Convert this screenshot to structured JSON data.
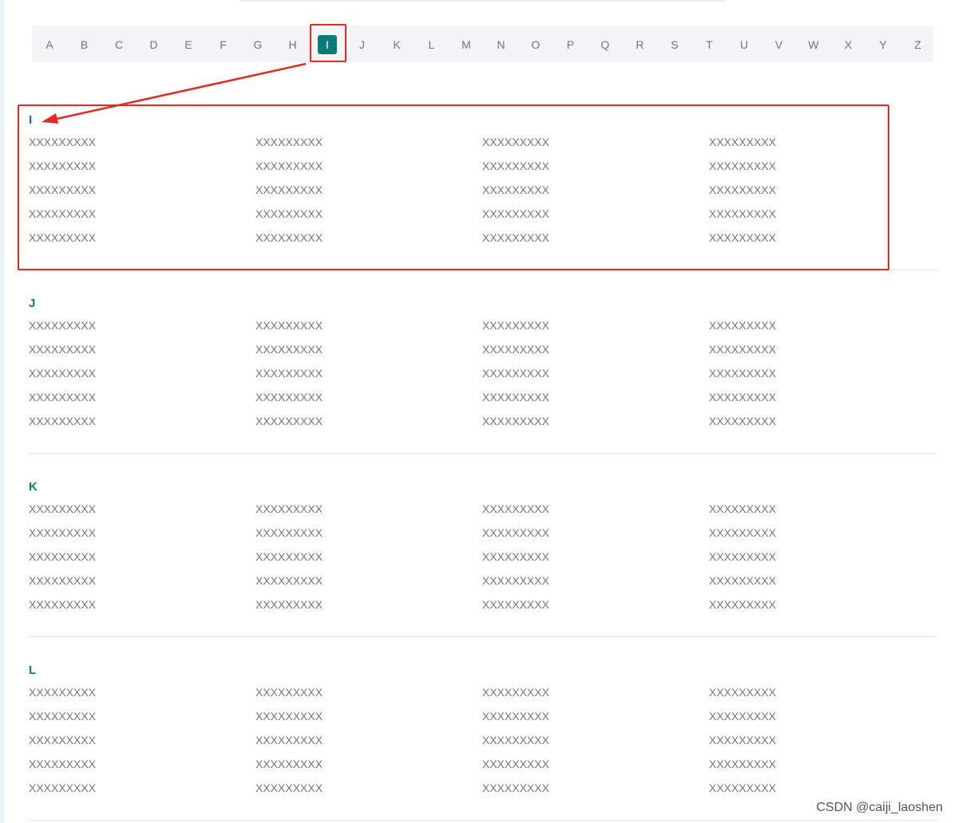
{
  "letters": [
    "A",
    "B",
    "C",
    "D",
    "E",
    "F",
    "G",
    "H",
    "I",
    "J",
    "K",
    "L",
    "M",
    "N",
    "O",
    "P",
    "Q",
    "R",
    "S",
    "T",
    "U",
    "V",
    "W",
    "X",
    "Y",
    "Z"
  ],
  "active_letter": "I",
  "sections": [
    {
      "title": "I",
      "rows": [
        [
          "XXXXXXXXX",
          "XXXXXXXXX",
          "XXXXXXXXX",
          "XXXXXXXXX"
        ],
        [
          "XXXXXXXXX",
          "XXXXXXXXX",
          "XXXXXXXXX",
          "XXXXXXXXX"
        ],
        [
          "XXXXXXXXX",
          "XXXXXXXXX",
          "XXXXXXXXX",
          "XXXXXXXXX"
        ],
        [
          "XXXXXXXXX",
          "XXXXXXXXX",
          "XXXXXXXXX",
          "XXXXXXXXX"
        ],
        [
          "XXXXXXXXX",
          "XXXXXXXXX",
          "XXXXXXXXX",
          "XXXXXXXXX"
        ]
      ]
    },
    {
      "title": "J",
      "rows": [
        [
          "XXXXXXXXX",
          "XXXXXXXXX",
          "XXXXXXXXX",
          "XXXXXXXXX"
        ],
        [
          "XXXXXXXXX",
          "XXXXXXXXX",
          "XXXXXXXXX",
          "XXXXXXXXX"
        ],
        [
          "XXXXXXXXX",
          "XXXXXXXXX",
          "XXXXXXXXX",
          "XXXXXXXXX"
        ],
        [
          "XXXXXXXXX",
          "XXXXXXXXX",
          "XXXXXXXXX",
          "XXXXXXXXX"
        ],
        [
          "XXXXXXXXX",
          "XXXXXXXXX",
          "XXXXXXXXX",
          "XXXXXXXXX"
        ]
      ]
    },
    {
      "title": "K",
      "rows": [
        [
          "XXXXXXXXX",
          "XXXXXXXXX",
          "XXXXXXXXX",
          "XXXXXXXXX"
        ],
        [
          "XXXXXXXXX",
          "XXXXXXXXX",
          "XXXXXXXXX",
          "XXXXXXXXX"
        ],
        [
          "XXXXXXXXX",
          "XXXXXXXXX",
          "XXXXXXXXX",
          "XXXXXXXXX"
        ],
        [
          "XXXXXXXXX",
          "XXXXXXXXX",
          "XXXXXXXXX",
          "XXXXXXXXX"
        ],
        [
          "XXXXXXXXX",
          "XXXXXXXXX",
          "XXXXXXXXX",
          "XXXXXXXXX"
        ]
      ]
    },
    {
      "title": "L",
      "rows": [
        [
          "XXXXXXXXX",
          "XXXXXXXXX",
          "XXXXXXXXX",
          "XXXXXXXXX"
        ],
        [
          "XXXXXXXXX",
          "XXXXXXXXX",
          "XXXXXXXXX",
          "XXXXXXXXX"
        ],
        [
          "XXXXXXXXX",
          "XXXXXXXXX",
          "XXXXXXXXX",
          "XXXXXXXXX"
        ],
        [
          "XXXXXXXXX",
          "XXXXXXXXX",
          "XXXXXXXXX",
          "XXXXXXXXX"
        ],
        [
          "XXXXXXXXX",
          "XXXXXXXXX",
          "XXXXXXXXX",
          "XXXXXXXXX"
        ]
      ]
    }
  ],
  "colors": {
    "accent": "#0e7a78",
    "annotation": "#e8281f",
    "item_text": "#777777"
  },
  "watermark": "CSDN @caiji_laoshen"
}
